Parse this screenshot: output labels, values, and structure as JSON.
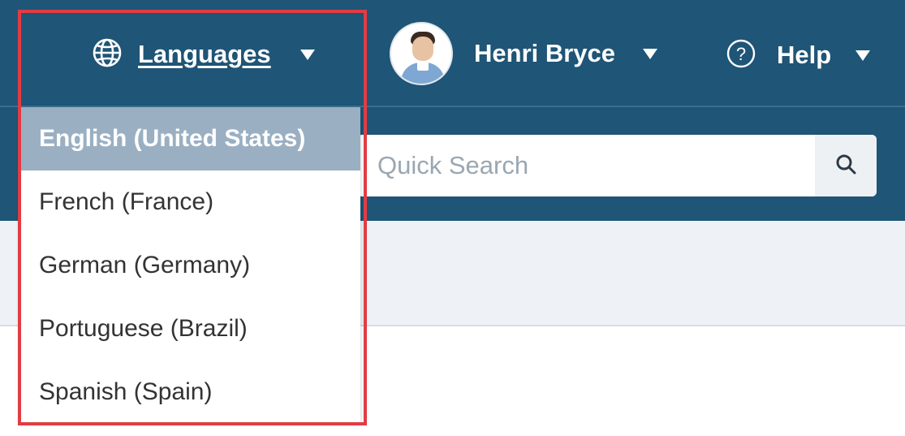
{
  "header": {
    "languages": {
      "label": "Languages",
      "icon": "globe-icon"
    },
    "user": {
      "name": "Henri Bryce",
      "avatar": "avatar"
    },
    "help": {
      "label": "Help",
      "icon": "help-circle-icon"
    }
  },
  "search": {
    "placeholder": "Quick Search",
    "value": "",
    "icon": "search-icon"
  },
  "language_menu": {
    "selected": "English (United States)",
    "items": [
      {
        "label": "English (United States)"
      },
      {
        "label": "French (France)"
      },
      {
        "label": "German (Germany)"
      },
      {
        "label": "Portuguese (Brazil)"
      },
      {
        "label": "Spanish (Spain)"
      }
    ]
  },
  "colors": {
    "header_bg": "#1f5576",
    "selected_item_bg": "#9aafc2",
    "highlight_border": "#e23c44"
  }
}
